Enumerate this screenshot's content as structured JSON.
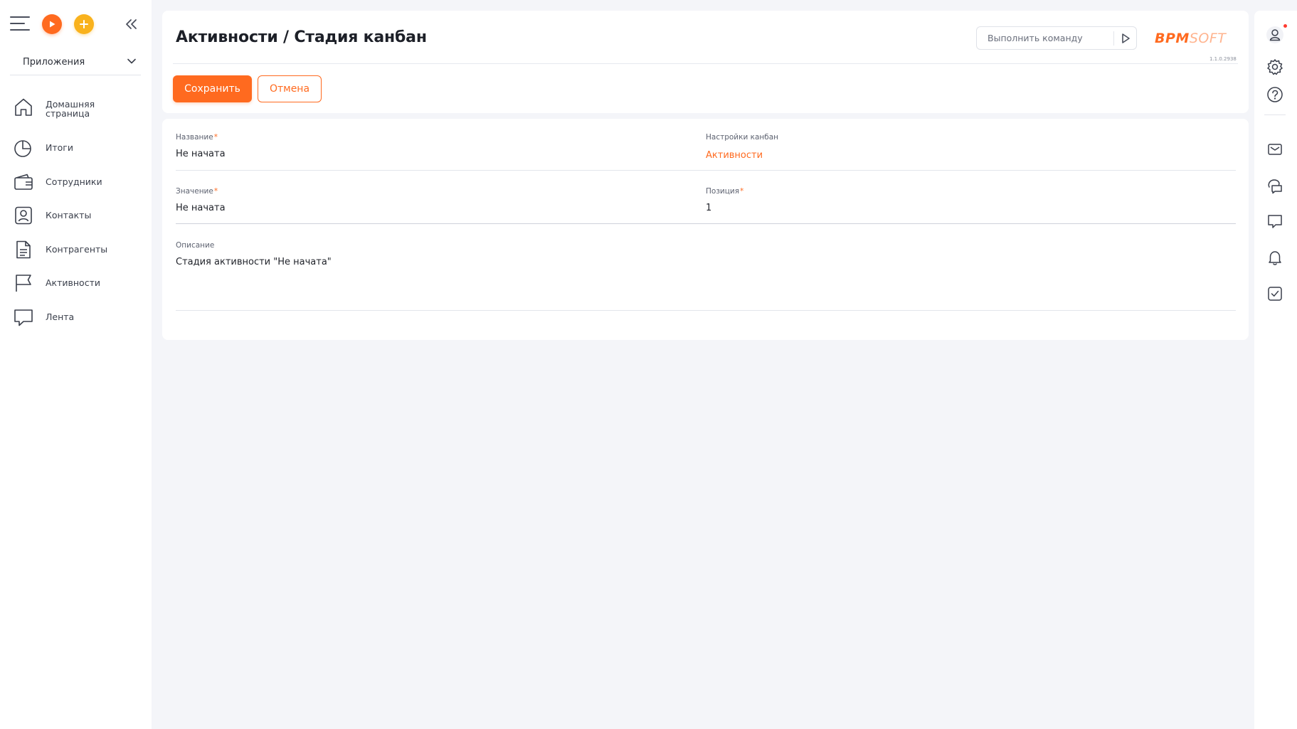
{
  "sidebar": {
    "apps_label": "Приложения",
    "nav": [
      {
        "label": "Домашняя страница",
        "icon": "home-icon"
      },
      {
        "label": "Итоги",
        "icon": "pie-chart-icon"
      },
      {
        "label": "Сотрудники",
        "icon": "wallet-icon"
      },
      {
        "label": "Контакты",
        "icon": "contact-card-icon"
      },
      {
        "label": "Контрагенты",
        "icon": "document-icon"
      },
      {
        "label": "Активности",
        "icon": "flag-icon"
      },
      {
        "label": "Лента",
        "icon": "chat-bubble-icon"
      }
    ]
  },
  "header": {
    "title": "Активности / Стадия канбан",
    "command_placeholder": "Выполнить команду",
    "logo_bpm": "BPM",
    "logo_soft": "SOFT",
    "version": "1.1.0.2938",
    "save_label": "Сохранить",
    "cancel_label": "Отмена"
  },
  "form": {
    "name_label": "Название",
    "name_value": "Не начата",
    "kanban_label": "Настройки канбан",
    "kanban_value": "Активности",
    "value_label": "Значение",
    "value_value": "Не начата",
    "position_label": "Позиция",
    "position_value": "1",
    "description_label": "Описание",
    "description_value": "Стадия активности \"Не начата\"",
    "required_mark": "*"
  },
  "rail": {
    "icons": [
      "user-icon",
      "settings-icon",
      "help-icon",
      "mail-icon",
      "chats-icon",
      "message-icon",
      "bell-icon",
      "tasks-icon"
    ]
  },
  "colors": {
    "accent": "#ff6a1f",
    "yellow": "#f9b21d",
    "background": "#f4f5f9",
    "notification_dot": "#ff3b30"
  }
}
